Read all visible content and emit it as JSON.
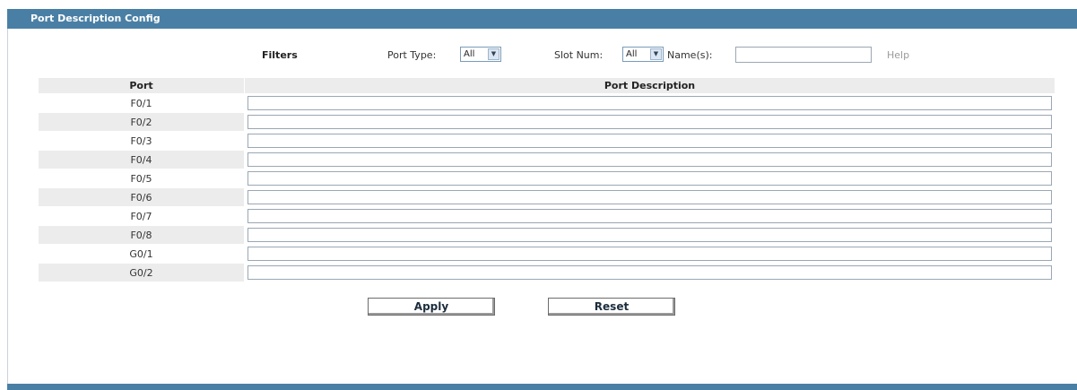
{
  "header": {
    "title": "Port Description Config"
  },
  "filters": {
    "label": "Filters",
    "port_type_label": "Port Type:",
    "port_type_value": "All",
    "slot_num_label": "Slot Num:",
    "slot_num_value": "All",
    "names_label": "Name(s):",
    "names_value": "",
    "help_label": "Help"
  },
  "table": {
    "headers": [
      "Port",
      "Port Description"
    ],
    "rows": [
      {
        "port": "F0/1",
        "description": ""
      },
      {
        "port": "F0/2",
        "description": ""
      },
      {
        "port": "F0/3",
        "description": ""
      },
      {
        "port": "F0/4",
        "description": ""
      },
      {
        "port": "F0/5",
        "description": ""
      },
      {
        "port": "F0/6",
        "description": ""
      },
      {
        "port": "F0/7",
        "description": ""
      },
      {
        "port": "F0/8",
        "description": ""
      },
      {
        "port": "G0/1",
        "description": ""
      },
      {
        "port": "G0/2",
        "description": ""
      }
    ]
  },
  "buttons": {
    "apply": "Apply",
    "reset": "Reset"
  },
  "colors": {
    "header_bg": "#4a7fa5",
    "row_shade": "#ececec"
  }
}
